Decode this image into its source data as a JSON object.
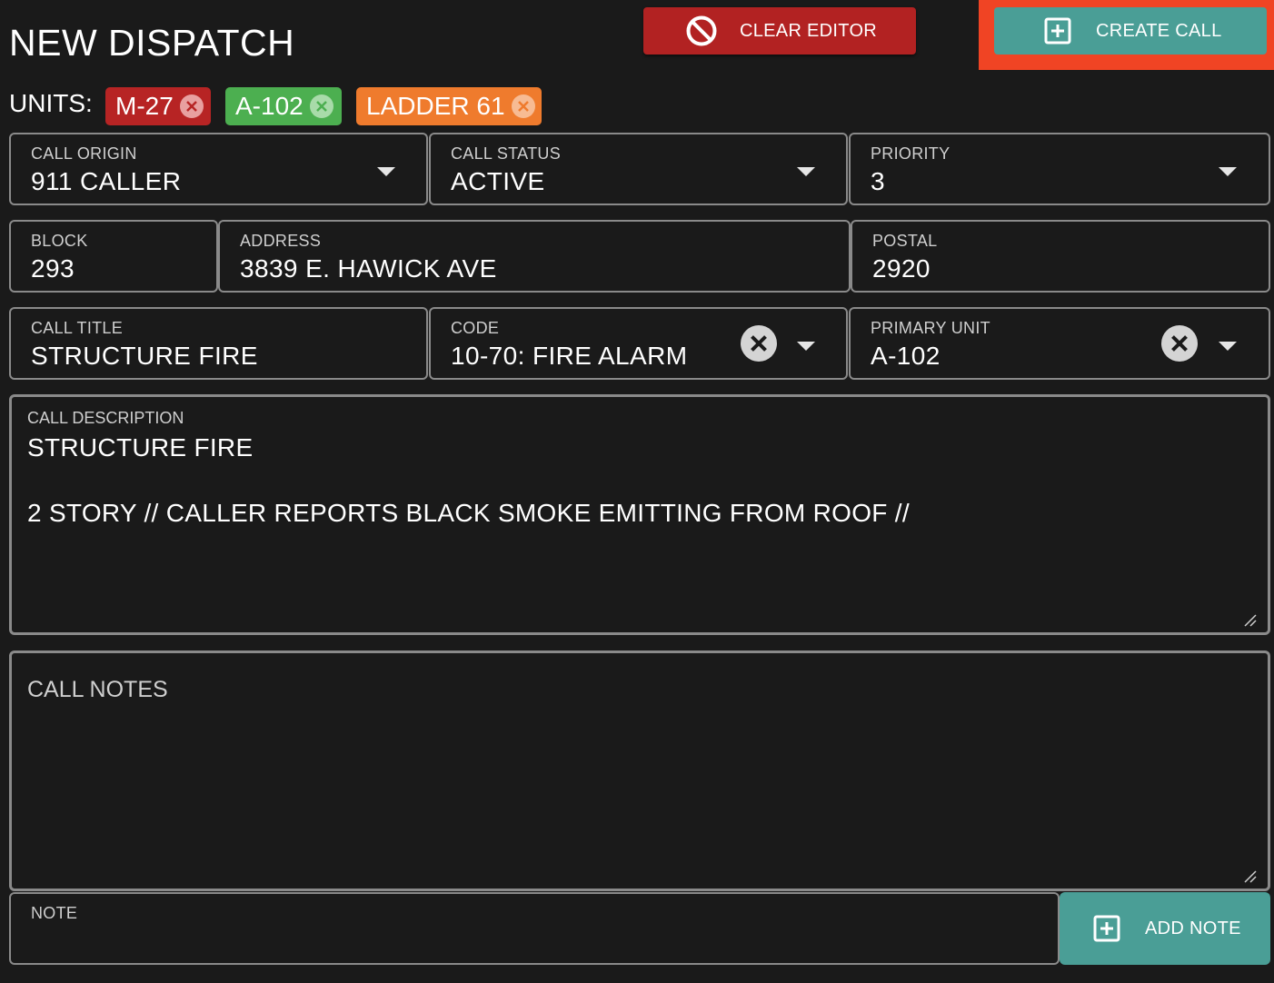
{
  "header": {
    "title": "NEW DISPATCH",
    "clear_label": "CLEAR EDITOR",
    "create_label": "CREATE CALL",
    "colors": {
      "clear": "#b22222",
      "create": "#4a9e96",
      "highlight": "#f04424"
    }
  },
  "units": {
    "label": "UNITS:",
    "chips": [
      {
        "label": "M-27",
        "color": "#b72424"
      },
      {
        "label": "A-102",
        "color": "#4caf50"
      },
      {
        "label": "LADDER 61",
        "color": "#ef7b2d"
      }
    ]
  },
  "fields": {
    "call_origin": {
      "label": "CALL ORIGIN",
      "value": "911 CALLER"
    },
    "call_status": {
      "label": "CALL STATUS",
      "value": "ACTIVE"
    },
    "priority": {
      "label": "PRIORITY",
      "value": "3"
    },
    "block": {
      "label": "BLOCK",
      "value": "293"
    },
    "address": {
      "label": "ADDRESS",
      "value": "3839 E. HAWICK AVE"
    },
    "postal": {
      "label": "POSTAL",
      "value": "2920"
    },
    "call_title": {
      "label": "CALL TITLE",
      "value": "STRUCTURE FIRE"
    },
    "code": {
      "label": "CODE",
      "value": "10-70: FIRE ALARM"
    },
    "primary_unit": {
      "label": "PRIMARY UNIT",
      "value": "A-102"
    }
  },
  "description": {
    "label": "CALL DESCRIPTION",
    "line1": "STRUCTURE FIRE",
    "line2": "2 STORY // CALLER REPORTS BLACK SMOKE EMITTING FROM ROOF //"
  },
  "notes": {
    "placeholder": "CALL NOTES"
  },
  "note_input": {
    "label": "NOTE",
    "value": ""
  },
  "add_note_label": "ADD NOTE"
}
